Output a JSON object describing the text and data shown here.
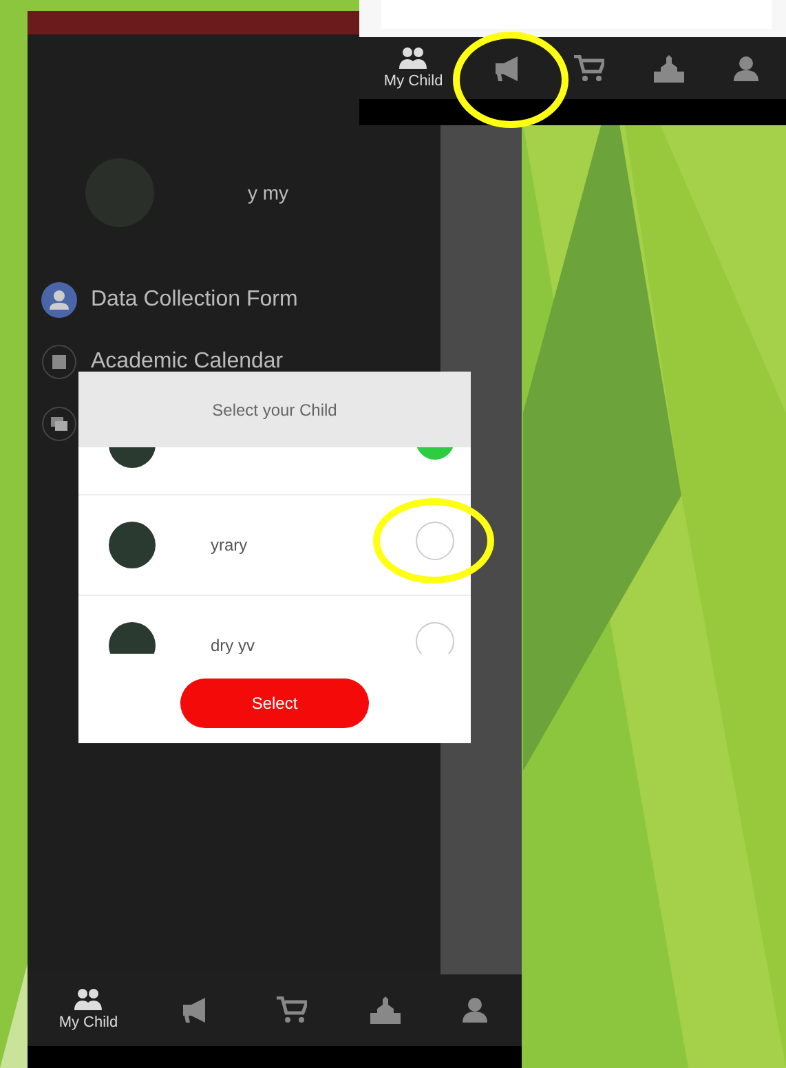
{
  "top_screen": {
    "tabs": [
      {
        "kind": "my-child",
        "label": "My Child",
        "selected": true
      },
      {
        "kind": "megaphone",
        "selected": false,
        "circled": true
      },
      {
        "kind": "cart",
        "selected": false
      },
      {
        "kind": "school",
        "selected": false
      },
      {
        "kind": "person",
        "selected": false
      }
    ]
  },
  "drawer": {
    "user_name": "y  my",
    "menu": [
      {
        "kind": "person",
        "label": "Data Collection Form"
      },
      {
        "kind": "calendar",
        "label": "Academic Calendar"
      },
      {
        "kind": "chat"
      }
    ]
  },
  "dialog": {
    "title": "Select your Child",
    "children": [
      {
        "selected": true
      },
      {
        "name": "yrary",
        "selected": false,
        "circled": true
      },
      {
        "name": "dry  yv",
        "selected": false
      }
    ],
    "button": "Select"
  },
  "bottom_nav": {
    "tabs": [
      {
        "kind": "my-child",
        "label": "My Child",
        "selected": true
      },
      {
        "kind": "megaphone",
        "selected": false
      },
      {
        "kind": "cart",
        "selected": false
      },
      {
        "kind": "school",
        "selected": false
      },
      {
        "kind": "person",
        "selected": false
      }
    ]
  }
}
